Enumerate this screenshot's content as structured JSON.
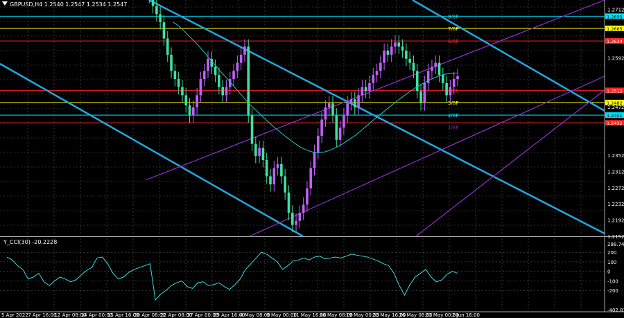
{
  "window": {
    "symbol_line": "GBPUSD,H4  1.2540 1.2547 1.2534 1.2547",
    "indicator_line": "Y_CCI(30) -20.2228"
  },
  "price_axis": {
    "ticks": [
      "1.2712",
      "1.2592",
      "1.2472",
      "1.2352",
      "1.2312",
      "1.2272",
      "1.2232",
      "1.2192",
      "1.2152"
    ],
    "plain_values": [
      1.2712,
      1.2592,
      1.2472,
      1.2352,
      1.2312,
      1.2272,
      1.2232,
      1.2192,
      1.2152
    ]
  },
  "labels": [
    {
      "text": "1.2695",
      "price": 1.2695,
      "color": "#00e5ff",
      "text_color": "#000"
    },
    {
      "text": "1.2665",
      "price": 1.2665,
      "color": "#ffff00",
      "text_color": "#000"
    },
    {
      "text": "1.2634",
      "price": 1.2634,
      "color": "#ff2020",
      "text_color": "#fff"
    },
    {
      "text": "1.2512",
      "price": 1.2512,
      "color": "#ff2020",
      "text_color": "#fff"
    },
    {
      "text": "1.2482",
      "price": 1.2482,
      "color": "#ffff00",
      "text_color": "#000"
    },
    {
      "text": "1.2451",
      "price": 1.2451,
      "color": "#00e5ff",
      "text_color": "#000"
    },
    {
      "text": "1.2432",
      "price": 1.2432,
      "color": "#ff2020",
      "text_color": "#fff"
    }
  ],
  "murrey": [
    {
      "text": "8/8P",
      "price": 1.2695,
      "color": "#00e5ff"
    },
    {
      "text": "7/8P",
      "price": 1.2665,
      "color": "#ffff00"
    },
    {
      "text": "6/8P",
      "price": 1.2634,
      "color": "#ff2020"
    },
    {
      "text": "4/8P",
      "price": 1.2512,
      "color": "#ff2020"
    },
    {
      "text": "3/8P",
      "price": 1.2482,
      "color": "#ffff00"
    },
    {
      "text": "2/8P",
      "price": 1.2451,
      "color": "#00e5ff"
    },
    {
      "text": "1/8P",
      "price": 1.2421,
      "color": "#7b30c0"
    }
  ],
  "cci_axis": {
    "ticks": [
      "288.7453",
      "200",
      "100",
      "0",
      "-100",
      "-200",
      "-402.8100"
    ],
    "values": [
      288.7453,
      200,
      100,
      0,
      -100,
      -200,
      -402.81
    ]
  },
  "time_axis": [
    "5 Apr 2022",
    "7 Apr 16:00",
    "12 Apr 08:00",
    "14 Apr 00:00",
    "15 Apr 16:00",
    "20 Apr 08:00",
    "22 Apr 08:00",
    "27 Apr 00:00",
    "29 Apr 16:00",
    "4 May 08:00",
    "9 May 00:00",
    "11 May 16:00",
    "16 May 08:00",
    "19 May 00:00",
    "23 May 16:00",
    "26 May 08:00",
    "31 May 00:00",
    "2 Jun 16:00"
  ],
  "colors": {
    "bull": "#c060ff",
    "bear": "#40e0a0",
    "ma": "#20c8c8",
    "channel_blue": "#20a8e0",
    "channel_purple": "#9030d0",
    "grid": "#5a5a5a",
    "cci": "#40d8e0"
  },
  "chart_data": {
    "type": "candlestick",
    "price_range": [
      1.2152,
      1.2735
    ],
    "cci_range": [
      -402.81,
      288.7453
    ],
    "closes": [
      1.276,
      1.2745,
      1.272,
      1.27,
      1.268,
      1.264,
      1.26,
      1.256,
      1.254,
      1.252,
      1.25,
      1.2475,
      1.245,
      1.247,
      1.25,
      1.254,
      1.256,
      1.259,
      1.257,
      1.255,
      1.252,
      1.25,
      1.252,
      1.254,
      1.256,
      1.258,
      1.26,
      1.262,
      1.245,
      1.238,
      1.235,
      1.237,
      1.234,
      1.23,
      1.228,
      1.232,
      1.233,
      1.23,
      1.226,
      1.221,
      1.218,
      1.219,
      1.221,
      1.223,
      1.227,
      1.232,
      1.236,
      1.24,
      1.244,
      1.247,
      1.248,
      1.245,
      1.239,
      1.242,
      1.245,
      1.248,
      1.249,
      1.247,
      1.25,
      1.252,
      1.251,
      1.253,
      1.255,
      1.256,
      1.258,
      1.261,
      1.26,
      1.262,
      1.263,
      1.262,
      1.261,
      1.259,
      1.258,
      1.256,
      1.251,
      1.248,
      1.253,
      1.256,
      1.257,
      1.258,
      1.255,
      1.253,
      1.25,
      1.252,
      1.254,
      1.2547
    ],
    "cci": [
      150,
      120,
      60,
      20,
      -80,
      -60,
      -20,
      -110,
      -150,
      -100,
      -60,
      -80,
      -110,
      -90,
      -40,
      10,
      40,
      140,
      150,
      80,
      -20,
      -80,
      -60,
      -10,
      20,
      40,
      60,
      80,
      -300,
      -240,
      -200,
      -150,
      -120,
      -100,
      -160,
      -180,
      -120,
      -110,
      -150,
      -140,
      -120,
      -160,
      -190,
      -140,
      -80,
      20,
      80,
      140,
      200,
      180,
      140,
      100,
      20,
      60,
      110,
      120,
      140,
      120,
      150,
      160,
      130,
      140,
      150,
      140,
      160,
      180,
      170,
      160,
      150,
      130,
      110,
      80,
      60,
      -20,
      -150,
      -250,
      -140,
      -60,
      -20,
      20,
      -60,
      -110,
      -90,
      -30,
      0,
      -20
    ],
    "ma": [
      1.268,
      1.267,
      1.2655,
      1.264,
      1.2625,
      1.2608,
      1.259,
      1.2573,
      1.2555,
      1.254,
      1.2522,
      1.2505,
      1.2488,
      1.2472,
      1.2458,
      1.2444,
      1.243,
      1.2417,
      1.2405,
      1.2393,
      1.2382,
      1.2372,
      1.2365,
      1.236,
      1.2358,
      1.236,
      1.2365,
      1.2372,
      1.238,
      1.239,
      1.24,
      1.2412,
      1.2425,
      1.2438,
      1.245,
      1.2462,
      1.2474,
      1.2486,
      1.2497,
      1.2508,
      1.2518,
      1.2527,
      1.2535,
      1.2542,
      1.2548,
      1.2552,
      1.2554,
      1.2555
    ]
  }
}
